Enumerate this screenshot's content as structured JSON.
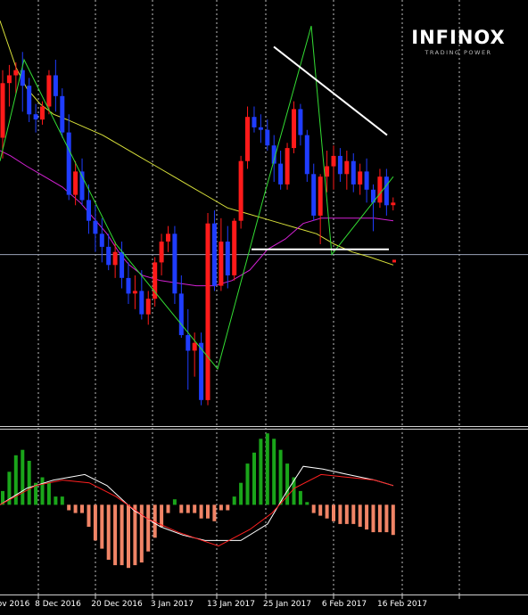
{
  "brand": {
    "name": "INFINOX",
    "tagline": "TRADING POWER"
  },
  "colors": {
    "background": "#000000",
    "bull": "#ff1a1a",
    "bear": "#1f3dff",
    "ma_slow": "#d8e03a",
    "ma_fast": "#d321d3",
    "zigzag": "#33dd33",
    "trendline": "#ffffff",
    "hline": "#9aa3b8",
    "hist_pos": "#1aa51a",
    "hist_neg": "#f08466",
    "macd_line": "#ffffff",
    "signal_line": "#ff2020",
    "vgrid": "#ffffff"
  },
  "chart_data": [
    {
      "type": "candlestick",
      "x_tick_labels": [
        "ov 2016",
        "8 Dec 2016",
        "20 Dec 2016",
        "3 Jan 2017",
        "13 Jan 2017",
        "25 Jan 2017",
        "6 Feb 2017",
        "16 Feb 2017"
      ],
      "ylim": [
        0,
        100
      ],
      "grid": "vertical dotted",
      "candles": [
        [
          73.5,
          86.5,
          69.5,
          84.0
        ],
        [
          84.0,
          87.5,
          79.5,
          85.5
        ],
        [
          85.5,
          88.0,
          82.0,
          86.5
        ],
        [
          86.5,
          90.0,
          78.5,
          83.5
        ],
        [
          83.5,
          85.0,
          76.5,
          78.0
        ],
        [
          78.0,
          80.0,
          74.5,
          77.0
        ],
        [
          77.0,
          80.5,
          76.0,
          79.5
        ],
        [
          79.5,
          86.5,
          78.0,
          85.5
        ],
        [
          85.5,
          88.5,
          78.5,
          81.5
        ],
        [
          81.5,
          83.0,
          73.5,
          74.5
        ],
        [
          74.5,
          78.0,
          61.5,
          62.5
        ],
        [
          62.5,
          69.0,
          60.5,
          67.0
        ],
        [
          67.0,
          69.5,
          60.5,
          61.5
        ],
        [
          61.5,
          64.5,
          55.0,
          57.5
        ],
        [
          57.5,
          60.5,
          51.5,
          55.0
        ],
        [
          55.0,
          58.0,
          49.5,
          52.5
        ],
        [
          52.5,
          55.0,
          48.0,
          49.0
        ],
        [
          49.0,
          53.5,
          46.5,
          51.5
        ],
        [
          51.5,
          53.5,
          44.5,
          46.5
        ],
        [
          46.5,
          49.5,
          41.5,
          43.5
        ],
        [
          43.5,
          47.0,
          40.5,
          44.0
        ],
        [
          44.0,
          48.0,
          38.5,
          39.5
        ],
        [
          39.5,
          44.0,
          37.5,
          42.5
        ],
        [
          42.5,
          50.5,
          41.0,
          49.5
        ],
        [
          49.5,
          55.0,
          47.0,
          53.5
        ],
        [
          53.5,
          56.5,
          51.5,
          55.0
        ],
        [
          55.0,
          56.5,
          41.5,
          43.5
        ],
        [
          43.5,
          47.0,
          35.0,
          35.5
        ],
        [
          35.5,
          40.5,
          25.0,
          32.5
        ],
        [
          32.5,
          36.0,
          27.5,
          34.0
        ],
        [
          34.0,
          36.0,
          22.0,
          23.0
        ],
        [
          23.0,
          59.0,
          22.0,
          57.0
        ],
        [
          57.0,
          59.5,
          44.0,
          45.0
        ],
        [
          45.0,
          58.0,
          44.0,
          53.5
        ],
        [
          53.5,
          56.5,
          44.5,
          47.0
        ],
        [
          47.0,
          58.0,
          46.0,
          57.5
        ],
        [
          57.5,
          70.0,
          56.0,
          69.0
        ],
        [
          69.0,
          79.5,
          67.5,
          77.5
        ],
        [
          77.5,
          79.5,
          74.5,
          75.5
        ],
        [
          75.5,
          78.0,
          72.5,
          75.0
        ],
        [
          75.0,
          77.0,
          71.0,
          72.0
        ],
        [
          72.0,
          74.0,
          65.0,
          68.5
        ],
        [
          68.5,
          71.0,
          63.5,
          64.5
        ],
        [
          64.5,
          72.5,
          63.5,
          71.5
        ],
        [
          71.5,
          80.5,
          70.5,
          79.0
        ],
        [
          79.0,
          80.0,
          72.0,
          74.0
        ],
        [
          74.0,
          75.0,
          65.0,
          66.5
        ],
        [
          66.5,
          68.5,
          57.5,
          58.5
        ],
        [
          58.5,
          66.5,
          53.0,
          66.0
        ],
        [
          66.0,
          71.0,
          63.0,
          68.0
        ],
        [
          68.0,
          72.0,
          63.5,
          70.0
        ],
        [
          70.0,
          71.5,
          65.0,
          66.5
        ],
        [
          66.5,
          71.0,
          63.5,
          69.0
        ],
        [
          69.0,
          70.5,
          63.0,
          64.5
        ],
        [
          64.5,
          68.5,
          62.5,
          67.0
        ],
        [
          67.0,
          69.5,
          61.0,
          63.5
        ],
        [
          63.5,
          64.5,
          55.5,
          61.0
        ],
        [
          61.0,
          67.5,
          60.0,
          66.0
        ],
        [
          66.0,
          67.5,
          58.5,
          60.5
        ],
        [
          60.5,
          62.0,
          59.5,
          61.0
        ]
      ],
      "ma_slow": [
        [
          0,
          96
        ],
        [
          8,
          92
        ],
        [
          18,
          87
        ],
        [
          30,
          83
        ],
        [
          45,
          80
        ],
        [
          60,
          78
        ],
        [
          75,
          77
        ],
        [
          95,
          75.5
        ],
        [
          115,
          74
        ],
        [
          135,
          72
        ],
        [
          155,
          70
        ],
        [
          175,
          68
        ],
        [
          195,
          66
        ],
        [
          215,
          64
        ],
        [
          235,
          62
        ],
        [
          255,
          60
        ],
        [
          275,
          59
        ],
        [
          295,
          58
        ],
        [
          315,
          57
        ],
        [
          335,
          56
        ],
        [
          355,
          55
        ],
        [
          375,
          53
        ],
        [
          395,
          51.5
        ],
        [
          415,
          50.5
        ],
        [
          441,
          49
        ]
      ],
      "ma_fast": [
        [
          0,
          71
        ],
        [
          12,
          70
        ],
        [
          30,
          68
        ],
        [
          50,
          66
        ],
        [
          70,
          64
        ],
        [
          90,
          61
        ],
        [
          105,
          58
        ],
        [
          120,
          55
        ],
        [
          135,
          51
        ],
        [
          145,
          49
        ],
        [
          160,
          47
        ],
        [
          180,
          46
        ],
        [
          200,
          45.5
        ],
        [
          220,
          45
        ],
        [
          240,
          45
        ],
        [
          260,
          46
        ],
        [
          280,
          48
        ],
        [
          300,
          52
        ],
        [
          320,
          54
        ],
        [
          340,
          57
        ],
        [
          360,
          58
        ],
        [
          380,
          58
        ],
        [
          400,
          58
        ],
        [
          420,
          58
        ],
        [
          441,
          57.5
        ]
      ],
      "zigzag": [
        [
          0,
          69
        ],
        [
          27,
          88.5
        ],
        [
          130,
          53
        ],
        [
          244,
          29
        ],
        [
          294,
          61
        ],
        [
          349,
          95
        ],
        [
          372,
          51
        ],
        [
          441,
          66
        ]
      ],
      "trendlines": [
        {
          "from": [
            307,
            91
          ],
          "to": [
            434,
            74
          ]
        },
        {
          "from": [
            282,
            52
          ],
          "to": [
            436,
            52
          ]
        }
      ],
      "hline": 51
    },
    {
      "type": "bar",
      "title": "",
      "ylim": [
        -32,
        28
      ],
      "histogram": [
        5,
        12,
        18,
        20,
        16,
        8,
        10,
        8,
        3,
        3,
        -2,
        -3,
        -3,
        -8,
        -13,
        -16,
        -20,
        -22,
        -22,
        -23,
        -22,
        -21,
        -17,
        -12,
        -8,
        -3,
        2,
        -3,
        -3,
        -3,
        -5,
        -5,
        -6,
        -2,
        -2,
        3,
        8,
        15,
        19,
        24,
        26,
        24,
        20,
        15,
        10,
        5,
        1,
        -3,
        -4,
        -5,
        -6,
        -7,
        -7,
        -7,
        -8,
        -9,
        -10,
        -10,
        -10,
        -11
      ],
      "macd_line": [
        [
          0,
          0
        ],
        [
          30,
          6
        ],
        [
          60,
          9
        ],
        [
          95,
          11
        ],
        [
          120,
          7
        ],
        [
          150,
          -2
        ],
        [
          180,
          -8
        ],
        [
          205,
          -11
        ],
        [
          230,
          -13
        ],
        [
          270,
          -13
        ],
        [
          300,
          -7
        ],
        [
          320,
          4
        ],
        [
          340,
          14
        ],
        [
          362,
          13
        ],
        [
          390,
          11
        ],
        [
          420,
          9
        ],
        [
          441,
          7
        ]
      ],
      "signal_line": [
        [
          0,
          0
        ],
        [
          40,
          7
        ],
        [
          70,
          9
        ],
        [
          100,
          8
        ],
        [
          130,
          3
        ],
        [
          165,
          -5
        ],
        [
          200,
          -10
        ],
        [
          245,
          -15
        ],
        [
          280,
          -9
        ],
        [
          305,
          -3
        ],
        [
          330,
          6
        ],
        [
          360,
          11
        ],
        [
          390,
          10
        ],
        [
          420,
          9
        ],
        [
          441,
          7
        ]
      ]
    }
  ]
}
